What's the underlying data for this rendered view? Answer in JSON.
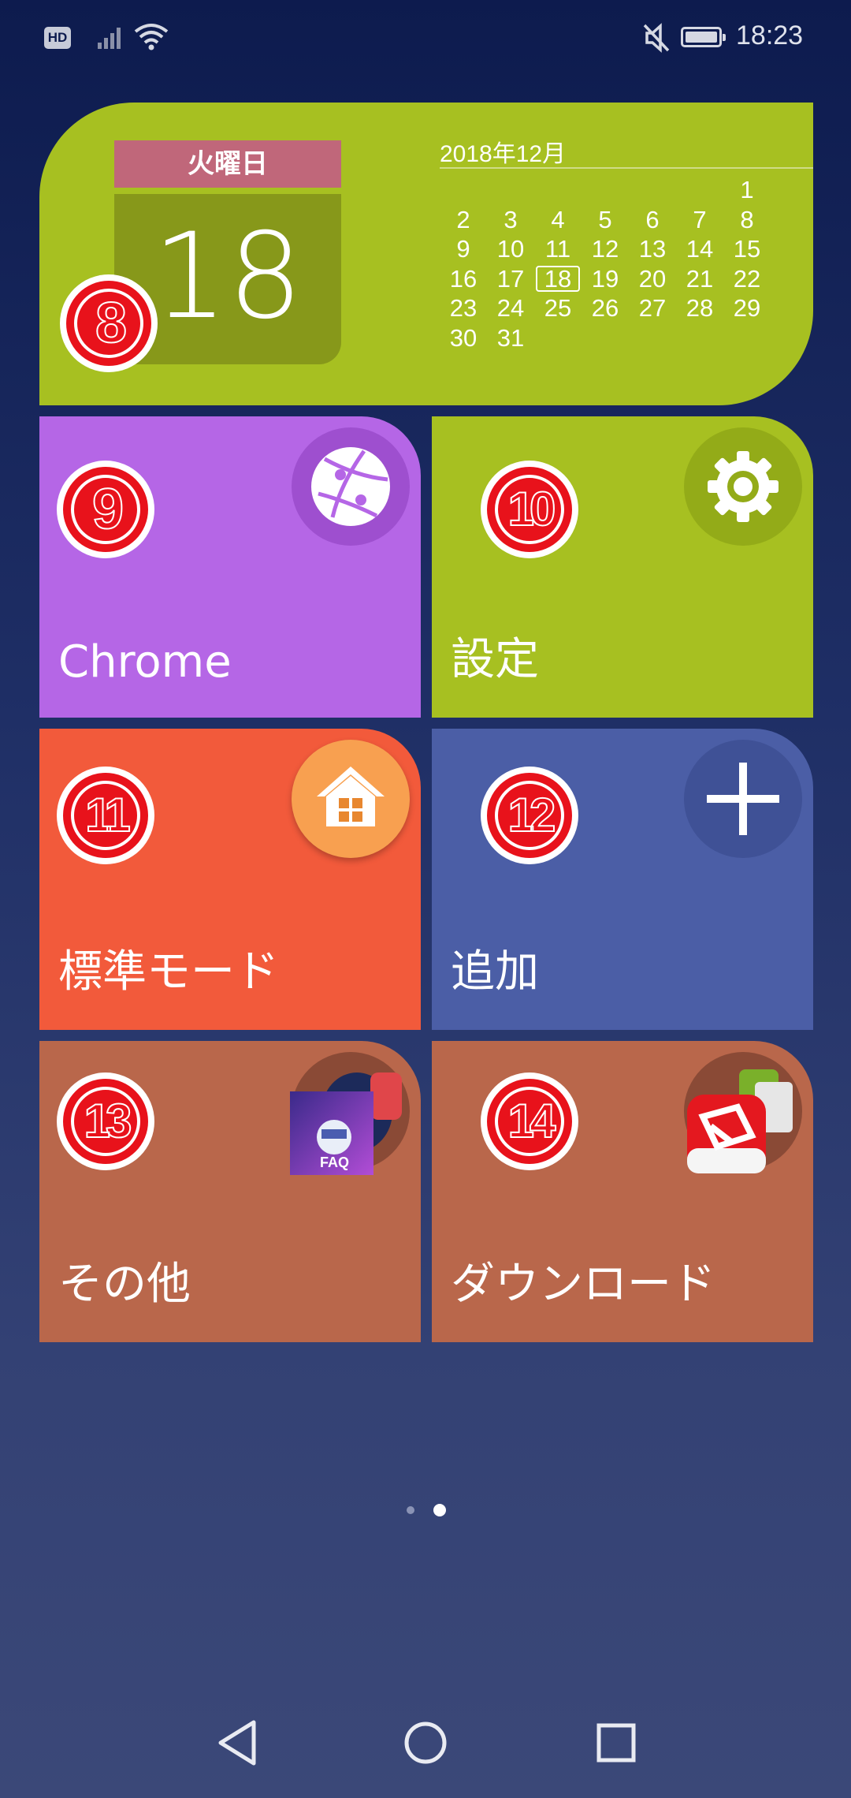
{
  "status_bar": {
    "hd_label": "HD",
    "time": "18:23",
    "icons": [
      "hd-icon",
      "signal-icon",
      "wifi-icon",
      "mute-icon",
      "battery-icon"
    ]
  },
  "calendar_widget": {
    "weekday": "火曜日",
    "day": "18",
    "month_label": "2018年12月",
    "today": "18",
    "dates": [
      "",
      "",
      "",
      "",
      "",
      "",
      "1",
      "2",
      "3",
      "4",
      "5",
      "6",
      "7",
      "8",
      "9",
      "10",
      "11",
      "12",
      "13",
      "14",
      "15",
      "16",
      "17",
      "18",
      "19",
      "20",
      "21",
      "22",
      "23",
      "24",
      "25",
      "26",
      "27",
      "28",
      "29",
      "30",
      "31"
    ],
    "badge": "8",
    "color": "#a7c021"
  },
  "tiles": [
    {
      "label": "Chrome",
      "badge": "9",
      "icon": "chrome-browser-icon",
      "color": "#b566e6"
    },
    {
      "label": "設定",
      "badge": "10",
      "icon": "gear-icon",
      "color": "#a7c021"
    },
    {
      "label": "標準モード",
      "badge": "11",
      "icon": "home-icon",
      "color": "#f25a3b"
    },
    {
      "label": "追加",
      "badge": "12",
      "icon": "plus-icon",
      "color": "#4b5ea6"
    },
    {
      "label": "その他",
      "badge": "13",
      "icon": "folder-apps-icon",
      "color": "#b9674b"
    },
    {
      "label": "ダウンロード",
      "badge": "14",
      "icon": "folder-downloads-icon",
      "color": "#b9674b"
    }
  ],
  "pager": {
    "pages": 2,
    "current": 2
  },
  "nav_bar": {
    "buttons": [
      "back-icon",
      "home-circle-icon",
      "recents-icon"
    ]
  }
}
